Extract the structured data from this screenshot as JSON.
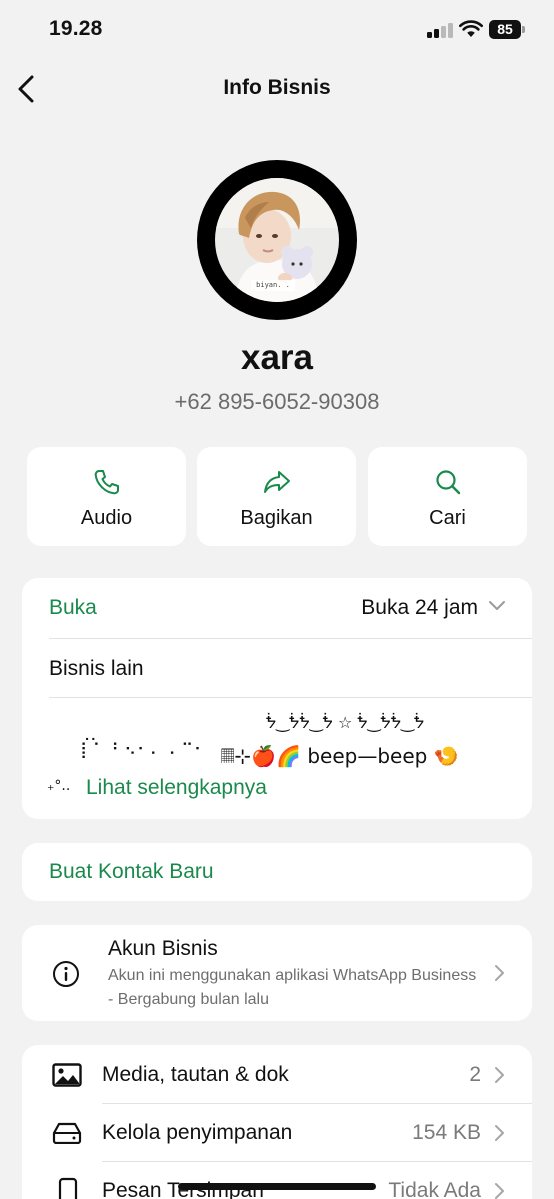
{
  "status_bar": {
    "time": "19.28",
    "battery": "85"
  },
  "nav": {
    "title": "Info Bisnis"
  },
  "profile": {
    "name": "xara",
    "phone": "+62 895-6052-90308",
    "avatar_caption": "biyan. ."
  },
  "actions": [
    {
      "label": "Audio",
      "icon": "phone-icon"
    },
    {
      "label": "Bagikan",
      "icon": "share-icon"
    },
    {
      "label": "Cari",
      "icon": "search-icon"
    }
  ],
  "business_card": {
    "hours_label": "Buka",
    "hours_value": "Buka 24 jam",
    "category": "Bisnis lain",
    "description_line1": "ᖭ‿ᖭᖭ‿ᖭ ☆ ᖭ‿ᖭᖭ‿ᖭ",
    "description_line2": "𝄜⊹🍎🌈 beep—beep 🍤",
    "description_prefix": "₊°..",
    "see_more": "Lihat selengkapnya"
  },
  "new_contact": {
    "label": "Buat Kontak Baru"
  },
  "business_account": {
    "title": "Akun Bisnis",
    "description": "Akun ini menggunakan aplikasi WhatsApp Business - Bergabung bulan lalu"
  },
  "list": [
    {
      "label": "Media, tautan & dok",
      "value": "2",
      "icon": "image-icon"
    },
    {
      "label": "Kelola penyimpanan",
      "value": "154 KB",
      "icon": "storage-icon"
    },
    {
      "label": "Pesan Tersimpan",
      "value": "Tidak Ada",
      "icon": "bookmark-phone-icon"
    }
  ],
  "colors": {
    "accent": "#1a8a4c",
    "background": "#f2f2f2",
    "card": "#ffffff"
  }
}
